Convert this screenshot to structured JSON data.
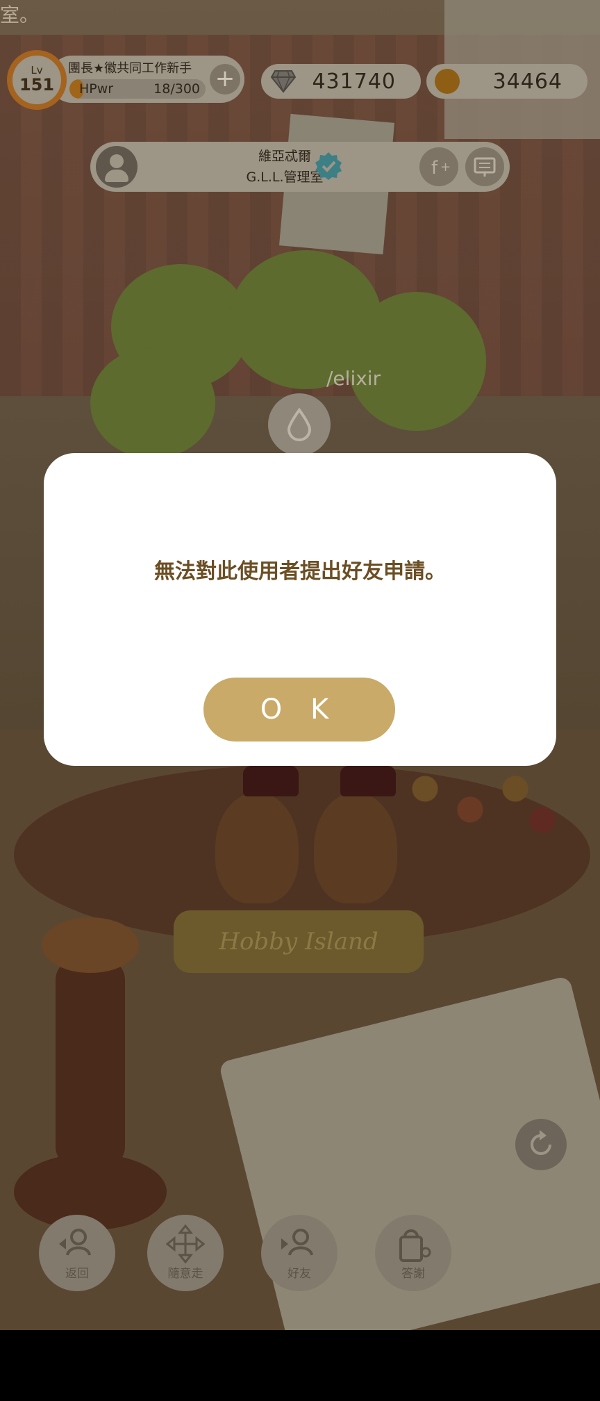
{
  "top_cut_text": "室。",
  "player": {
    "lv_label": "Lv",
    "level": "151",
    "title": "團長★徽共同工作新手",
    "hp_label": "HPwr",
    "hp_value": "18/300",
    "hp_fraction": 0.06,
    "add_icon": "plus-icon"
  },
  "currency": {
    "gems": "431740",
    "coins": "34464",
    "gem_icon": "diamond-icon",
    "coin_icon": "coin-icon"
  },
  "visited_user": {
    "name": "維亞忒爾",
    "room": "G.L.L.管理室",
    "verified_icon": "verified-badge-icon",
    "friend_icon": "add-friend-icon",
    "board_icon": "message-board-icon"
  },
  "scene": {
    "elixir_label": "/elixir",
    "plaque_text": "Hobby Island",
    "refresh_icon": "refresh-icon"
  },
  "nav": {
    "back": "返回",
    "wander": "隨意走",
    "friends": "好友",
    "thanks": "答謝"
  },
  "dialog": {
    "message": "無法對此使用者提出好友申請。",
    "ok_label": "O K"
  },
  "colors": {
    "dialog_bg": "#ffffff",
    "ok_button": "#c9aa68",
    "message_text": "#6b4e24"
  }
}
